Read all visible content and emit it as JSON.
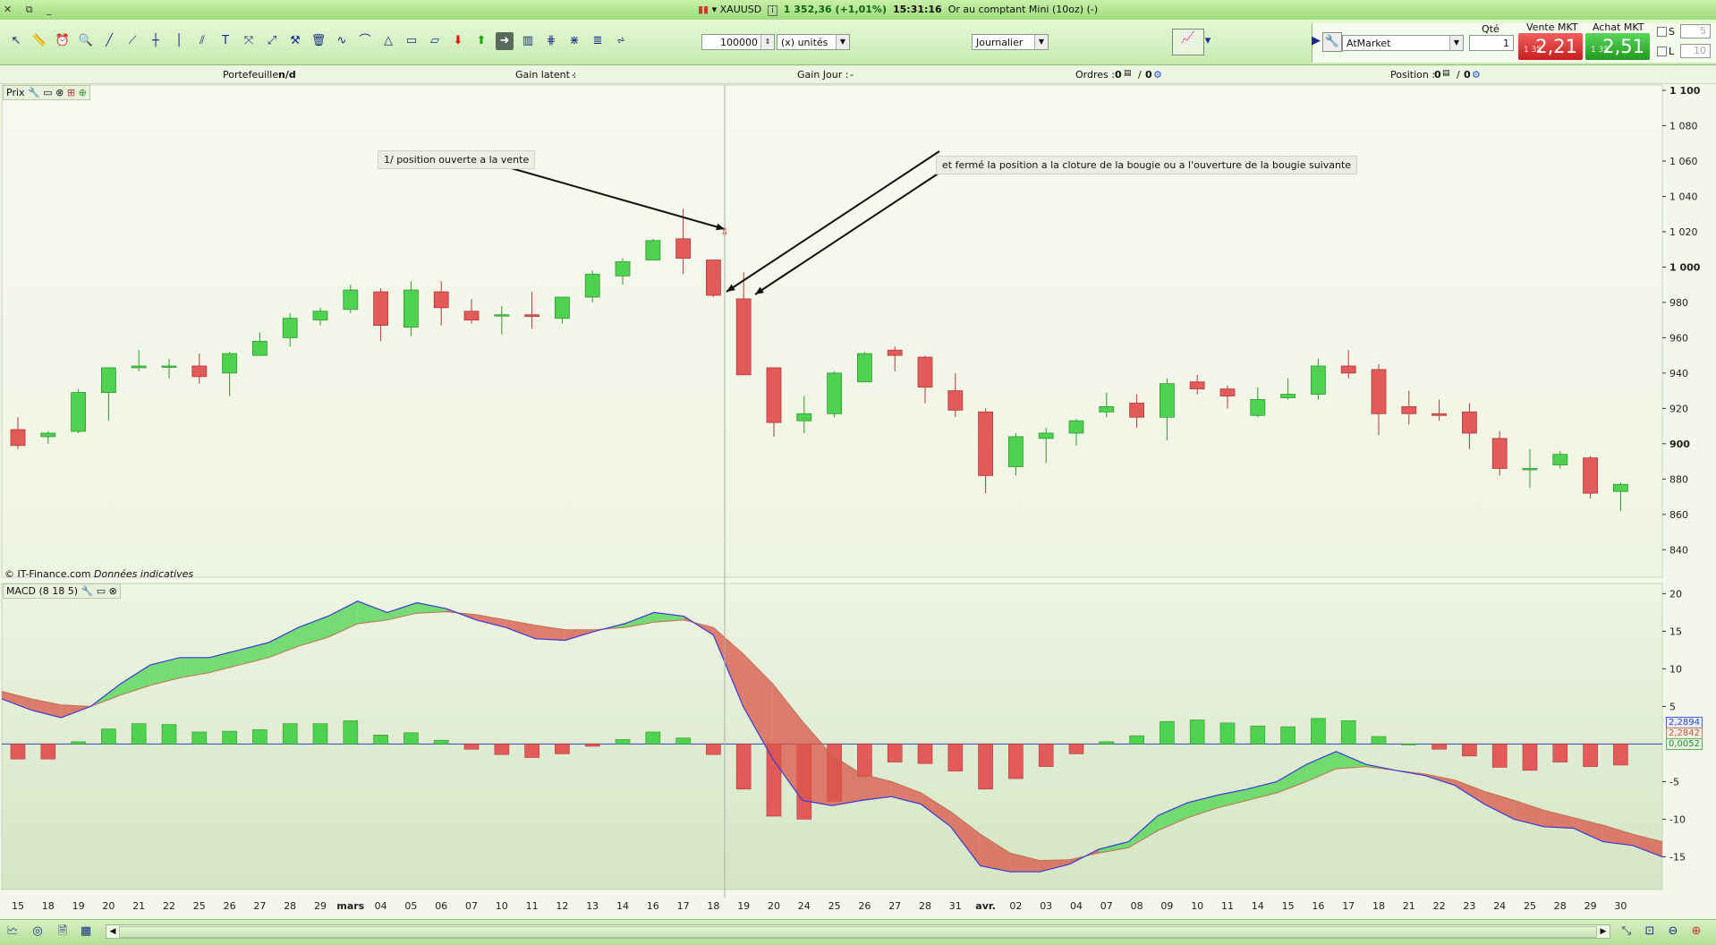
{
  "window": {
    "symbol": "XAUUSD",
    "price_change": "1 352,36 (+1,01%)",
    "time": "15:31:16",
    "description": "Or au comptant Mini (10oz) (-)"
  },
  "toolbar": {
    "quantity": "100000",
    "unit": "(x) unités",
    "period": "Journalier",
    "order_type": "AtMarket",
    "qty_label": "Qté",
    "qty_value": "1",
    "sell_label": "Vente MKT",
    "sell_small": "1 35",
    "sell_big": "2,21",
    "buy_label": "Achat MKT",
    "buy_small": "1 35",
    "buy_big": "2,51",
    "s_label": "S",
    "s_value": "5",
    "l_label": "L",
    "l_value": "10"
  },
  "infobar": {
    "portfolio_label": "Portefeuille :",
    "portfolio_value": "n/d",
    "latent_label": "Gain latent :",
    "latent_value": "-",
    "day_label": "Gain Jour :",
    "day_value": "-",
    "orders_label": "Ordres :",
    "orders_value_1": "0",
    "orders_value_2": "0",
    "position_label": "Position :",
    "position_value_1": "0",
    "position_value_2": "0"
  },
  "price_panel": {
    "tag": "Prix",
    "copyright": "© IT-Finance.com",
    "disclaimer": "Données indicatives",
    "annotation_1": "1/ position ouverte a la vente",
    "annotation_2": "et fermé la position a la cloture de la bougie ou a l'ouverture de la bougie suivante"
  },
  "macd_panel": {
    "tag": "MACD (8 18 5)",
    "value_1": "2,2894",
    "value_2": "2,2842",
    "value_3": "0,0052"
  },
  "colors": {
    "up": "#4fd24f",
    "down": "#e25a5a",
    "macd_line": "#3a3ad6",
    "signal_line": "#c07050"
  },
  "chart_data": [
    {
      "type": "candlestick",
      "y_axis_ticks": [
        "1 100",
        "1 080",
        "1 060",
        "1 040",
        "1 020",
        "1 000",
        "980",
        "960",
        "940",
        "920",
        "900",
        "880",
        "860",
        "840"
      ],
      "ylim": [
        828,
        1100
      ],
      "x": [
        "15",
        "18",
        "19",
        "20",
        "21",
        "22",
        "25",
        "26",
        "27",
        "28",
        "29",
        "mars",
        "04",
        "05",
        "06",
        "07",
        "10",
        "11",
        "12",
        "13",
        "14",
        "16",
        "17",
        "18",
        "19",
        "20",
        "24",
        "25",
        "26",
        "27",
        "28",
        "31",
        "avr.",
        "02",
        "03",
        "04",
        "07",
        "08",
        "09",
        "10",
        "11",
        "14",
        "15",
        "16",
        "17",
        "18",
        "21",
        "22",
        "23",
        "24",
        "25",
        "28",
        "29",
        "30"
      ],
      "ohlc": [
        [
          908,
          915,
          897,
          899
        ],
        [
          904,
          907,
          900,
          906
        ],
        [
          907,
          931,
          906,
          929
        ],
        [
          929,
          943,
          913,
          943
        ],
        [
          943,
          953,
          941,
          944
        ],
        [
          944,
          948,
          937,
          944
        ],
        [
          944,
          951,
          934,
          938
        ],
        [
          940,
          952,
          927,
          951
        ],
        [
          950,
          963,
          950,
          958
        ],
        [
          960,
          974,
          955,
          971
        ],
        [
          970,
          977,
          967,
          975
        ],
        [
          976,
          990,
          974,
          987
        ],
        [
          986,
          988,
          958,
          967
        ],
        [
          966,
          992,
          961,
          987
        ],
        [
          986,
          992,
          967,
          977
        ],
        [
          975,
          982,
          968,
          970
        ],
        [
          973,
          978,
          962,
          973
        ],
        [
          973,
          986,
          965,
          972
        ],
        [
          971,
          983,
          968,
          983
        ],
        [
          983,
          998,
          980,
          996
        ],
        [
          995,
          1005,
          990,
          1003
        ],
        [
          1004,
          1016,
          1004,
          1015
        ],
        [
          1016,
          1033,
          996,
          1005
        ],
        [
          1004,
          1004,
          983,
          984
        ],
        [
          982,
          997,
          940,
          939
        ],
        [
          943,
          943,
          904,
          912
        ],
        [
          913,
          927,
          906,
          917
        ],
        [
          917,
          941,
          915,
          940
        ],
        [
          935,
          952,
          935,
          951
        ],
        [
          953,
          955,
          941,
          950
        ],
        [
          949,
          950,
          923,
          932
        ],
        [
          930,
          940,
          915,
          919
        ],
        [
          918,
          920,
          872,
          882
        ],
        [
          887,
          906,
          882,
          904
        ],
        [
          903,
          909,
          889,
          906
        ],
        [
          906,
          914,
          899,
          913
        ],
        [
          918,
          929,
          915,
          921
        ],
        [
          923,
          928,
          909,
          915
        ],
        [
          915,
          937,
          902,
          934
        ],
        [
          935,
          939,
          928,
          931
        ],
        [
          931,
          933,
          920,
          927
        ],
        [
          916,
          932,
          915,
          925
        ],
        [
          926,
          937,
          925,
          928
        ],
        [
          928,
          948,
          925,
          944
        ],
        [
          944,
          953,
          937,
          940
        ],
        [
          942,
          945,
          905,
          917
        ],
        [
          921,
          930,
          911,
          917
        ],
        [
          917,
          925,
          913,
          916
        ],
        [
          918,
          923,
          897,
          906
        ],
        [
          903,
          907,
          882,
          886
        ],
        [
          886,
          897,
          875,
          886
        ],
        [
          888,
          896,
          886,
          894
        ],
        [
          892,
          893,
          869,
          872
        ],
        [
          873,
          878,
          862,
          877
        ]
      ]
    },
    {
      "type": "macd",
      "y_axis_ticks": [
        "20",
        "15",
        "10",
        "5",
        "-5",
        "-10",
        "-15"
      ],
      "ylim": [
        -19,
        21
      ],
      "macd": [
        6,
        4.5,
        3.5,
        5,
        8,
        10.5,
        11.5,
        11.5,
        12.5,
        13.5,
        15.5,
        17,
        19,
        17.5,
        18.8,
        18,
        16.5,
        15.5,
        14,
        13.8,
        15,
        16,
        17.5,
        17,
        14.5,
        5,
        -2,
        -7.5,
        -8.2,
        -7.5,
        -7,
        -8,
        -11,
        -16.2,
        -17,
        -17,
        -16,
        -14,
        -13,
        -9.5,
        -7.8,
        -6.8,
        -6,
        -5,
        -2.7,
        -1,
        -2.7,
        -3.5,
        -4.2,
        -5.5,
        -8,
        -10,
        -11,
        -11.2,
        -13,
        -13.5,
        -15
      ],
      "signal": [
        7,
        6,
        5.2,
        5,
        6.5,
        7.8,
        8.8,
        9.5,
        10.5,
        11.5,
        13,
        14.2,
        16,
        16.5,
        17.4,
        17.6,
        17.2,
        16.5,
        15.8,
        15.2,
        15.2,
        15.5,
        16.2,
        16.5,
        15.5,
        12,
        8,
        3,
        -1.5,
        -4,
        -5,
        -6.5,
        -9,
        -12,
        -14.5,
        -15.5,
        -15.4,
        -14.5,
        -13.8,
        -11.5,
        -9.8,
        -8.5,
        -7.5,
        -6.5,
        -5,
        -3.3,
        -3,
        -3.5,
        -4,
        -4.8,
        -6.3,
        -7.5,
        -8.8,
        -9.8,
        -10.8,
        -12,
        -13
      ],
      "histogram": [
        -2,
        -2,
        0.3,
        2,
        2.7,
        2.6,
        1.6,
        1.7,
        1.9,
        2.7,
        2.7,
        3.1,
        1.2,
        1.5,
        0.5,
        -0.7,
        -1.4,
        -1.8,
        -1.3,
        -0.3,
        0.6,
        1.6,
        0.8,
        -1.4,
        -6,
        -9.6,
        -10,
        -7.6,
        -4.3,
        -2.4,
        -2.6,
        -3.6,
        -6,
        -4.6,
        -3,
        -1.3,
        0.3,
        1.1,
        3,
        3.2,
        2.8,
        2.4,
        2.3,
        3.4,
        3.1,
        1,
        0,
        -0.7,
        -1.6,
        -3.1,
        -3.5,
        -2.4,
        -3,
        -2.8
      ]
    }
  ]
}
